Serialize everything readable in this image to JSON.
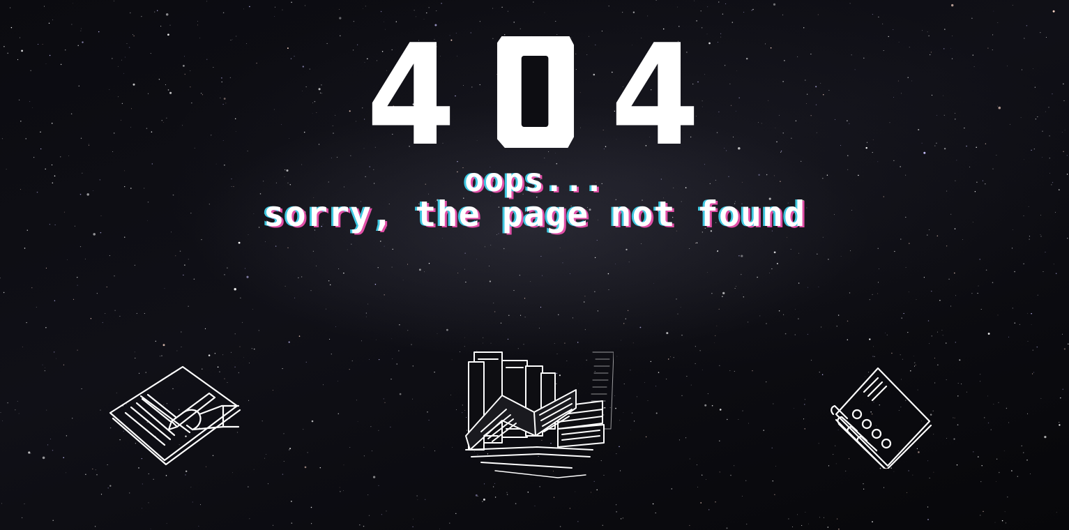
{
  "error": {
    "code_digits": [
      "4",
      "0",
      "4"
    ]
  },
  "message": {
    "line1": "oops...",
    "line2": "sorry, the page not found"
  },
  "illustrations": {
    "left": "writing-hand-notebook-icon",
    "center": "books-stack-icon",
    "right": "spiral-notepad-icon"
  },
  "colors": {
    "background": "#050507",
    "text": "#ffffff",
    "glitch_cyan": "#3ec7e0",
    "glitch_pink": "#e04fa6"
  }
}
